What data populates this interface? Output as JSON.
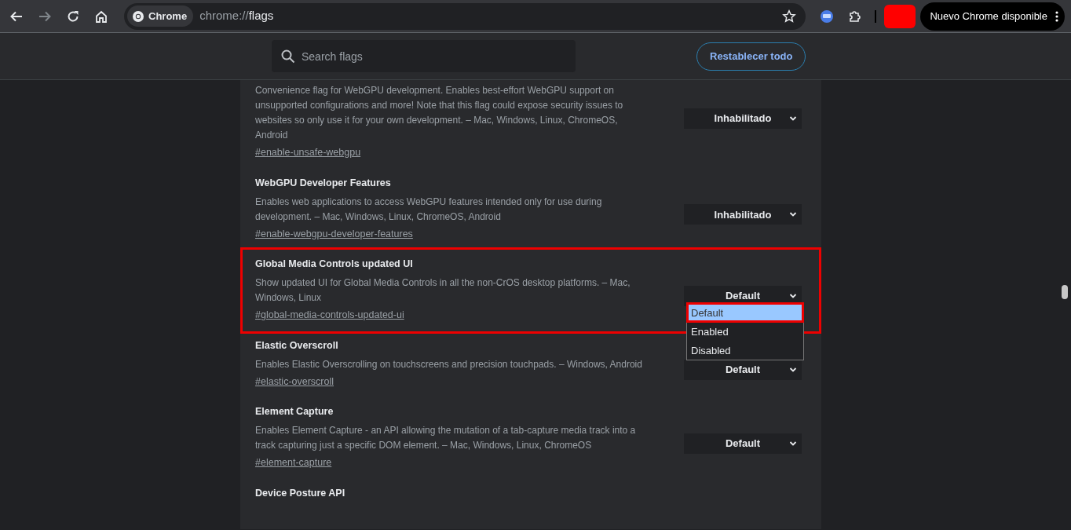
{
  "toolbar": {
    "back_enabled": true,
    "forward_enabled": false,
    "chip": "Chrome",
    "url_scheme": "chrome://",
    "url_path": "flags",
    "update_button": "Nuevo Chrome disponible"
  },
  "header": {
    "search_placeholder": "Search flags",
    "reset_button": "Restablecer todo"
  },
  "flags": [
    {
      "description": "Convenience flag for WebGPU development. Enables best-effort WebGPU support on unsupported configurations and more! Note that this flag could expose security issues to websites so only use it for your own development. – Mac, Windows, Linux, ChromeOS, Android",
      "link": "#enable-unsafe-webgpu",
      "value": "Inhabilitado",
      "highlighted": false
    },
    {
      "title": "WebGPU Developer Features",
      "description": "Enables web applications to access WebGPU features intended only for use during development. – Mac, Windows, Linux, ChromeOS, Android",
      "link": "#enable-webgpu-developer-features",
      "value": "Inhabilitado",
      "highlighted": false
    },
    {
      "title": "Global Media Controls updated UI",
      "description": "Show updated UI for Global Media Controls in all the non-CrOS desktop platforms. – Mac, Windows, Linux",
      "link": "#global-media-controls-updated-ui",
      "value": "Default",
      "highlighted": true,
      "options": [
        {
          "label": "Default",
          "selected": true,
          "outlined": true
        },
        {
          "label": "Enabled",
          "selected": false,
          "outlined": false
        },
        {
          "label": "Disabled",
          "selected": false,
          "outlined": false
        }
      ]
    },
    {
      "title": "Elastic Overscroll",
      "description": "Enables Elastic Overscrolling on touchscreens and precision touchpads. – Windows, Android",
      "link": "#elastic-overscroll",
      "value": "Default",
      "highlighted": false
    },
    {
      "title": "Element Capture",
      "description": "Enables Element Capture - an API allowing the mutation of a tab-capture media track into a track capturing just a specific DOM element. – Mac, Windows, Linux, ChromeOS",
      "link": "#element-capture",
      "value": "Default",
      "highlighted": false
    },
    {
      "title": "Device Posture API",
      "highlighted": false
    }
  ]
}
